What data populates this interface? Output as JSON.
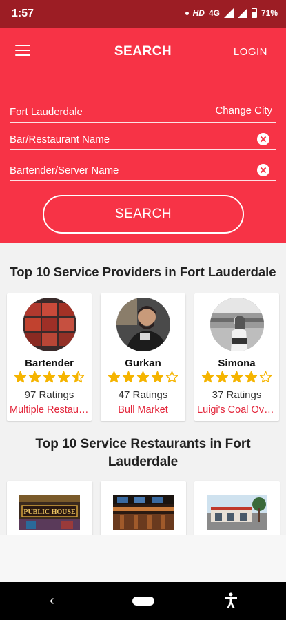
{
  "status_bar": {
    "time": "1:57",
    "network": "HD",
    "signal": "4G",
    "battery": "71%"
  },
  "header": {
    "title": "SEARCH",
    "login_label": "LOGIN"
  },
  "search": {
    "city_value": "Fort Lauderdale",
    "change_city_label": "Change City",
    "restaurant_value": "Bar/Restaurant Name",
    "staff_value": "Bartender/Server Name",
    "button_label": "SEARCH"
  },
  "providers": {
    "title": "Top 10 Service Providers in Fort Lauderdale",
    "items": [
      {
        "name": "Bartender",
        "stars": 4.5,
        "ratings": "97 Ratings",
        "place": "Multiple Restaurants"
      },
      {
        "name": "Gurkan",
        "stars": 4.0,
        "ratings": "47 Ratings",
        "place": "Bull Market"
      },
      {
        "name": "Simona",
        "stars": 4.0,
        "ratings": "37 Ratings",
        "place": "Luigi's Coal Oven Pizza"
      }
    ]
  },
  "restaurants": {
    "title_line1": "Top 10 Service Restaurants in Fort",
    "title_line2": "Lauderdale",
    "sign_text": "PUBLIC HOUSE"
  },
  "colors": {
    "accent": "#f73346",
    "status_bar": "#9c1d24",
    "star": "#f5b400",
    "link_red": "#e3263b"
  }
}
